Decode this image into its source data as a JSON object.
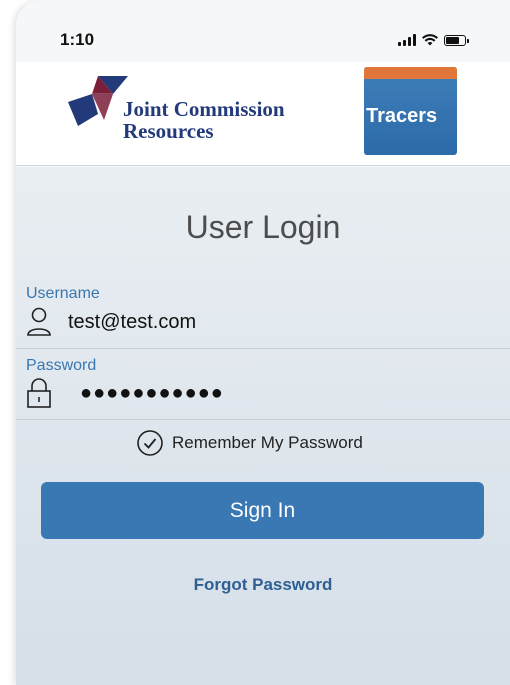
{
  "status_bar": {
    "time": "1:10",
    "icons": [
      "signal-icon",
      "wifi-icon",
      "battery-icon"
    ]
  },
  "header": {
    "brand_line1": "Joint Commission",
    "brand_line2": "Resources",
    "app_badge": "Tracers",
    "colors": {
      "brand_blue": "#233a7a",
      "brand_maroon": "#7a1e3a",
      "badge_orange": "#e0763a",
      "badge_blue": "#3f7fb9"
    }
  },
  "login": {
    "title": "User Login",
    "username_label": "Username",
    "username_value": "test@test.com",
    "password_label": "Password",
    "password_value": "●●●●●●●●●●●",
    "remember_label": "Remember My Password",
    "remember_checked": true,
    "signin_label": "Sign In",
    "forgot_label": "Forgot Password"
  },
  "colors": {
    "accent": "#3a78b4",
    "label_blue": "#3a77b0",
    "link_blue": "#2f5f92"
  }
}
